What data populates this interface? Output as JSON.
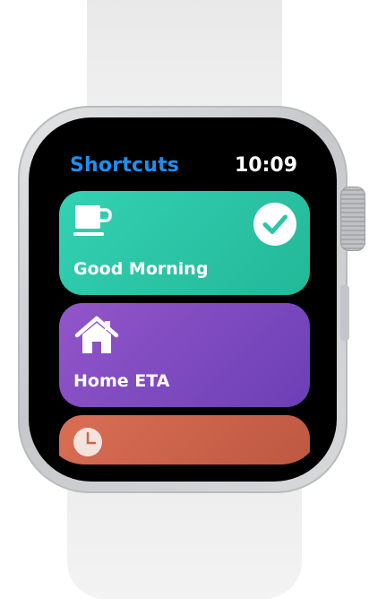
{
  "app": {
    "title": "Shortcuts",
    "time": "10:09"
  },
  "shortcuts": [
    {
      "label": "Good Morning",
      "icon": "coffee-cup-icon",
      "color": "#2bc6a7",
      "status": "checkmark-icon"
    },
    {
      "label": "Home ETA",
      "icon": "house-icon",
      "color": "#7e49bf"
    },
    {
      "label": "",
      "icon": "clock-icon",
      "color": "#cc644b"
    }
  ],
  "colors": {
    "accent": "#1e8ff0",
    "screen_bg": "#000000"
  }
}
